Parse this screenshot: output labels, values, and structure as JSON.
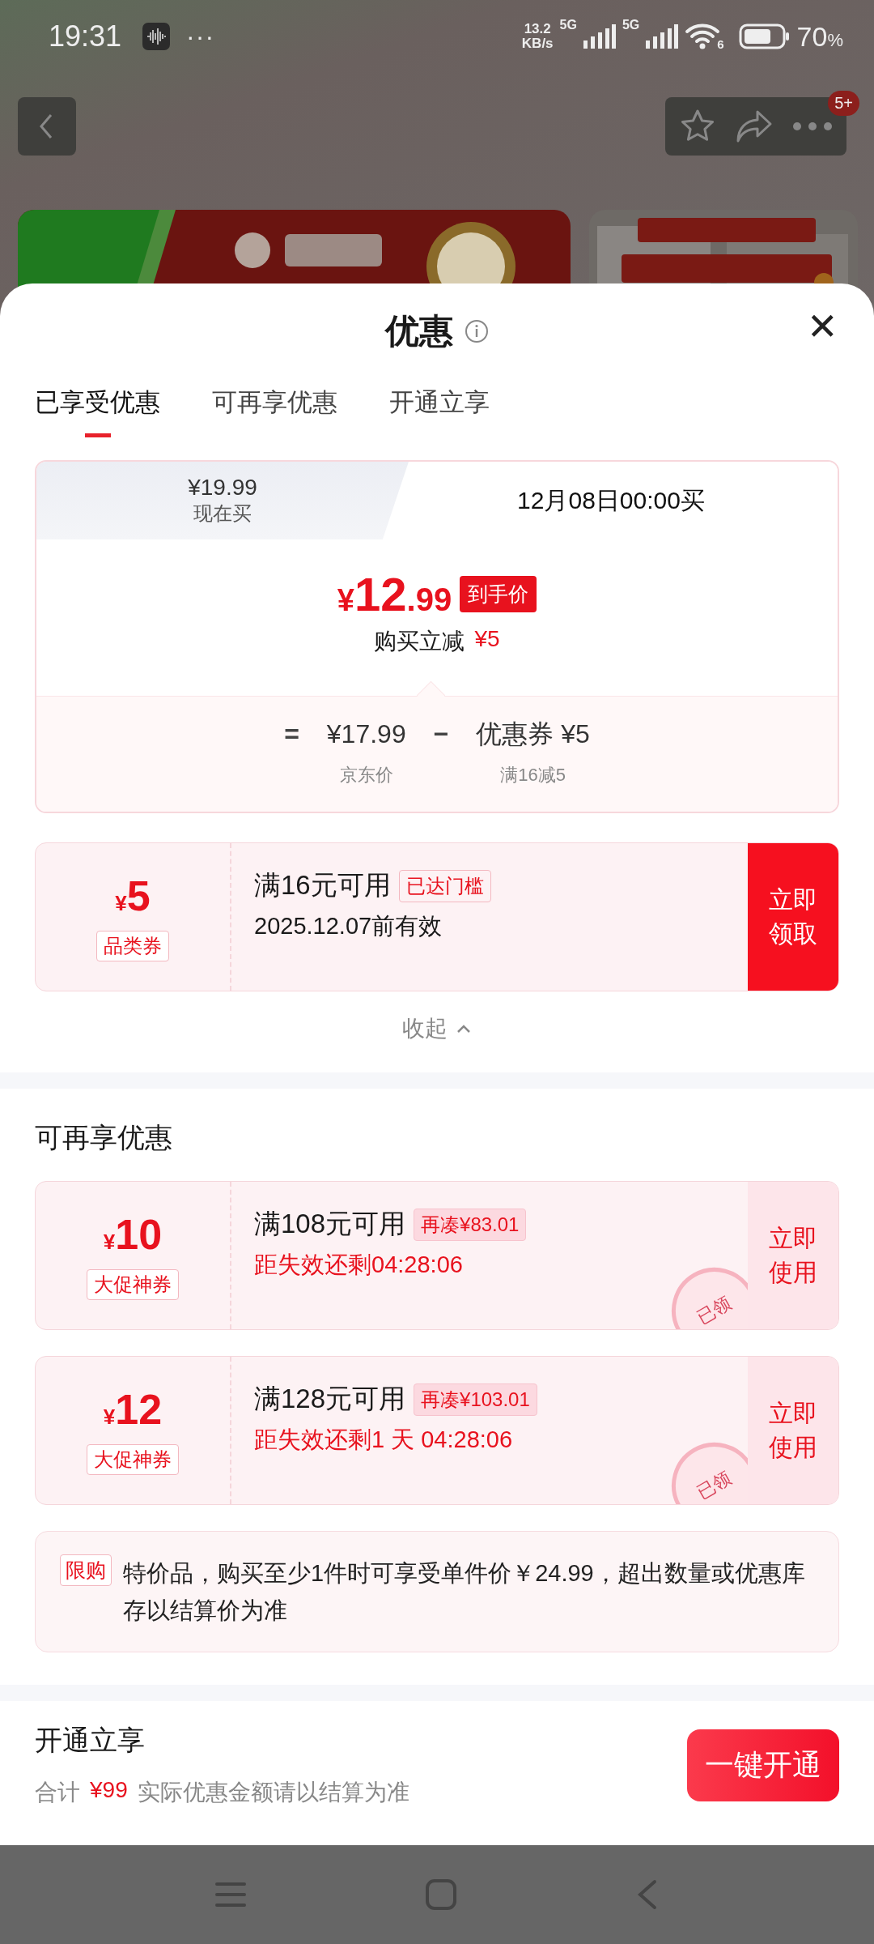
{
  "status_bar": {
    "time": "19:31",
    "more": "···",
    "net_speed": "13.2",
    "net_unit": "KB/s",
    "signals": [
      "5G",
      "5G"
    ],
    "wifi_label": "6",
    "battery": "70",
    "battery_unit": "%"
  },
  "nav": {
    "badge": "5+"
  },
  "sheet": {
    "title": "优惠",
    "close": "✕",
    "tabs": [
      {
        "label": "已享受优惠",
        "selected": true
      },
      {
        "label": "可再享优惠",
        "selected": false
      },
      {
        "label": "开通立享",
        "selected": false
      }
    ],
    "price_card": {
      "options": [
        {
          "price": "¥19.99",
          "label": "现在买",
          "selected": false
        },
        {
          "label": "12月08日00:00买",
          "selected": true
        }
      ],
      "final": {
        "currency": "¥",
        "integer": "12",
        "decimal": ".99",
        "badge": "到手价"
      },
      "saving": {
        "label": "购买立减",
        "amount": "¥5"
      },
      "formula": [
        {
          "kind": "op",
          "text": "="
        },
        {
          "kind": "term",
          "text": "¥17.99",
          "caption": "京东价"
        },
        {
          "kind": "op",
          "text": "−"
        },
        {
          "kind": "term",
          "text": "优惠券 ¥5",
          "caption": "满16减5"
        }
      ]
    },
    "enjoyed_coupons": [
      {
        "kind": "claim",
        "currency": "¥",
        "amount": "5",
        "type": "品类券",
        "condition": "满16元可用",
        "tag": "已达门槛",
        "note": "2025.12.07前有效",
        "button": "立即领取",
        "claimed": false
      }
    ],
    "collapse": "收起",
    "more_title": "可再享优惠",
    "more_coupons": [
      {
        "kind": "use",
        "currency": "¥",
        "amount": "10",
        "type": "大促神券",
        "condition": "满108元可用",
        "tag": "再凑¥83.01",
        "note": "距失效还剩04:28:06",
        "button": "立即使用",
        "claimed": true,
        "stamp": "已领"
      },
      {
        "kind": "use",
        "currency": "¥",
        "amount": "12",
        "type": "大促神券",
        "condition": "满128元可用",
        "tag": "再凑¥103.01",
        "note": "距失效还剩1 天 04:28:06",
        "button": "立即使用",
        "claimed": true,
        "stamp": "已领"
      }
    ],
    "limit_note": {
      "badge": "限购",
      "text": "特价品，购买至少1件时可享受单件价￥24.99，超出数量或优惠库存以结算价为准"
    },
    "membership": {
      "title": "开通立享",
      "total_label": "合计",
      "total": "¥99",
      "hint": "实际优惠金额请以结算为准",
      "button": "一键开通"
    }
  }
}
